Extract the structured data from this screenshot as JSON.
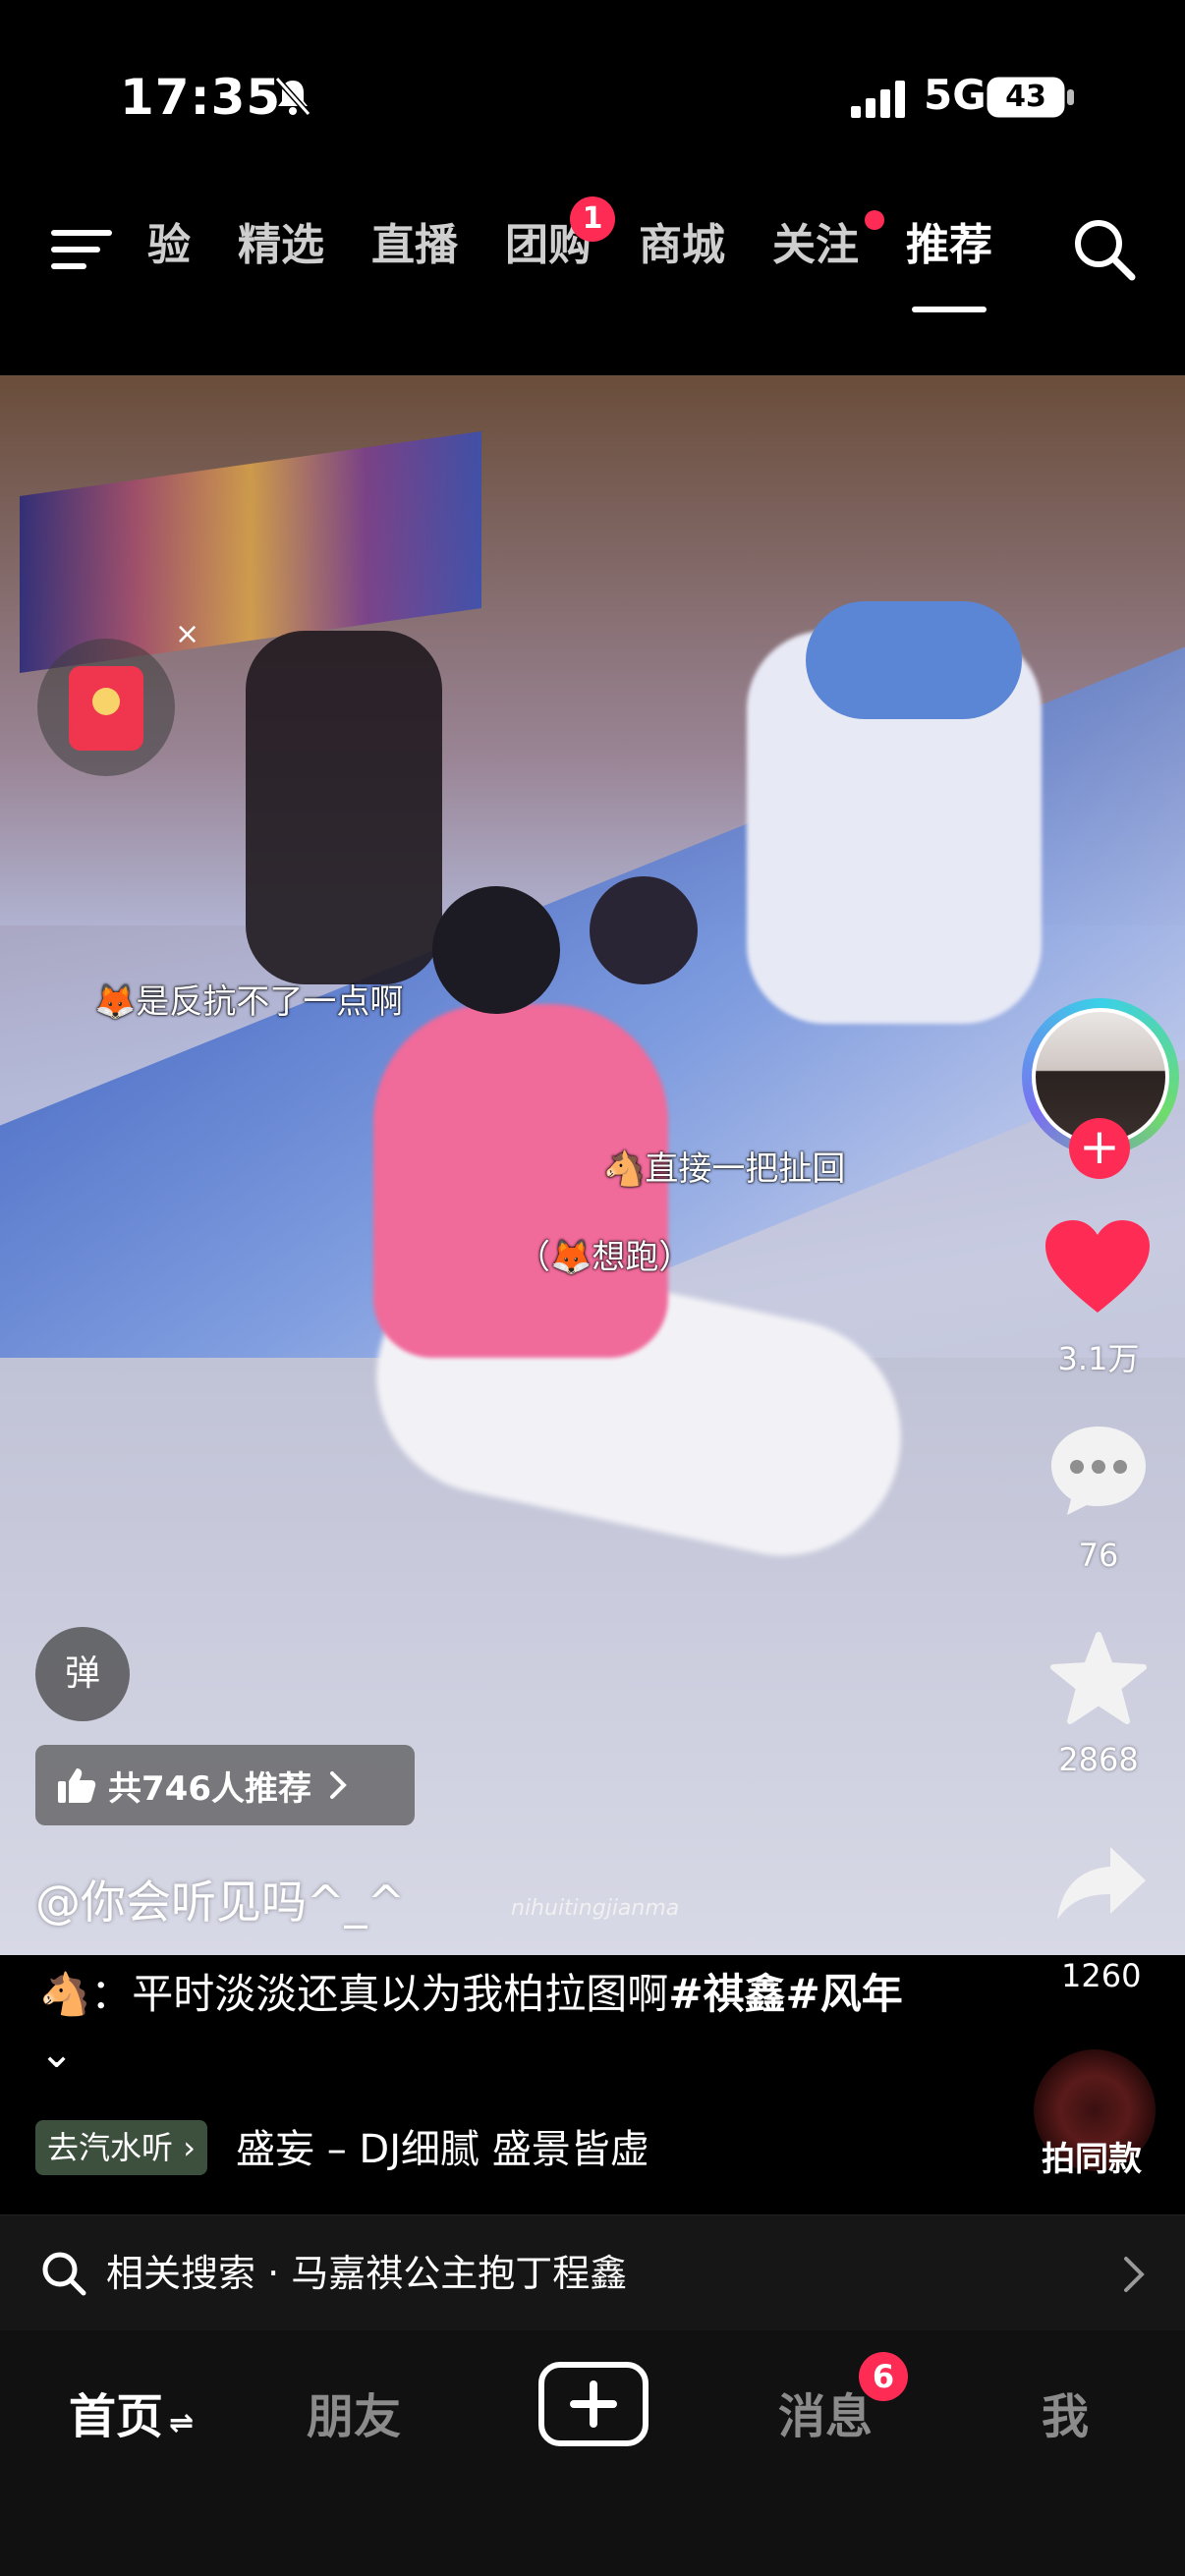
{
  "status_bar": {
    "time": "17:35",
    "network": "5G",
    "battery": "43"
  },
  "top_nav": {
    "tabs": [
      {
        "label": "验"
      },
      {
        "label": "精选"
      },
      {
        "label": "直播"
      },
      {
        "label": "团购",
        "badge": "1"
      },
      {
        "label": "商城"
      },
      {
        "label": "关注"
      },
      {
        "label": "推荐"
      }
    ],
    "active_tab": "推荐"
  },
  "video": {
    "danmu": [
      "🦊是反抗不了一点啊",
      "🐴直接一把扯回",
      "（🦊想跑）"
    ],
    "watermark": "nihuitingjianma",
    "close_mark": "×"
  },
  "actions": {
    "follow": "+",
    "likes": "3.1万",
    "comments": "76",
    "favorites": "2868",
    "shares": "1260"
  },
  "overlay": {
    "danmaku_toggle": "弹",
    "recommend_pill": "共746人推荐",
    "author": "@你会听见吗^_^"
  },
  "description": {
    "emoji": "🐴",
    "text": "：平时淡淡还真以为我柏拉图啊",
    "hashtags": "#祺鑫#风年",
    "expand": "⌄"
  },
  "music": {
    "tag": "去汽水听",
    "name": "盛妄 – DJ细腻  盛景皆虚",
    "same_button": "拍同款"
  },
  "related_search": {
    "label": "相关搜索 · 马嘉祺公主抱丁程鑫"
  },
  "bottom_tabs": {
    "home": "首页",
    "home_suffix": "⇌",
    "friends": "朋友",
    "messages": "消息",
    "messages_badge": "6",
    "me": "我"
  },
  "colors": {
    "accent": "#fe2c55",
    "like": "#fe2c55"
  }
}
